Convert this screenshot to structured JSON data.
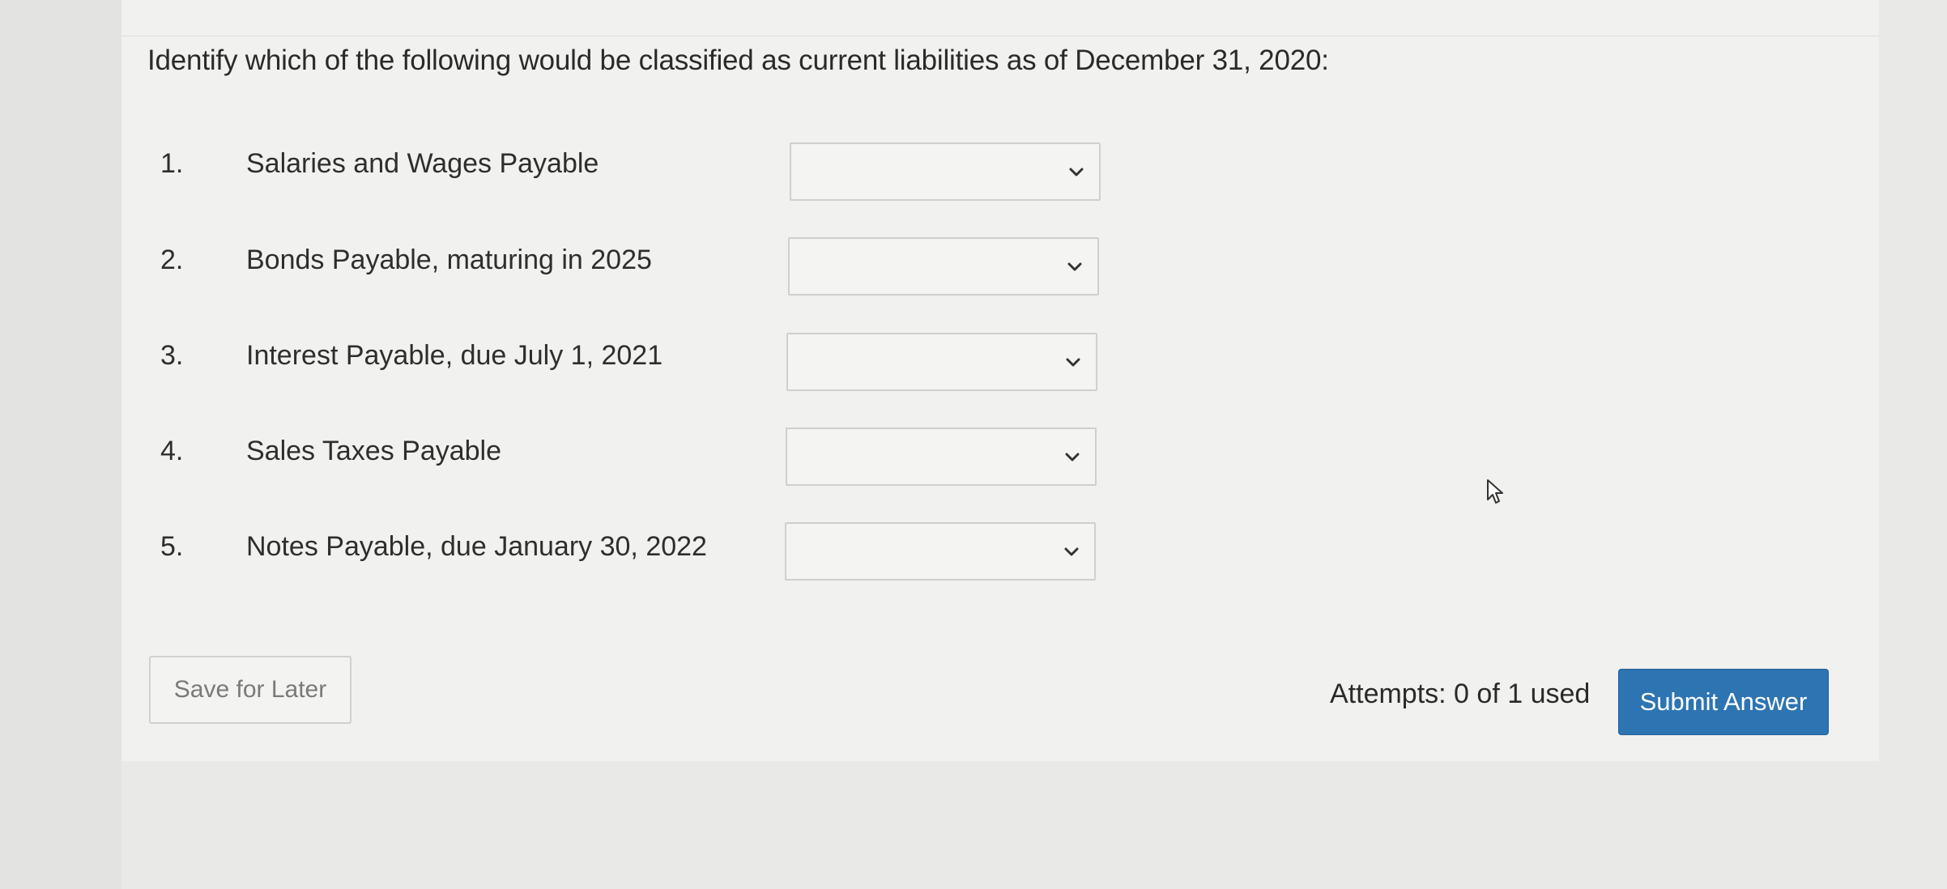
{
  "question": {
    "prompt": "Identify which of the following would be classified as current liabilities as of December 31, 2020:"
  },
  "items": [
    {
      "number": "1.",
      "label": "Salaries and Wages Payable",
      "selected": ""
    },
    {
      "number": "2.",
      "label": "Bonds Payable, maturing in 2025",
      "selected": ""
    },
    {
      "number": "3.",
      "label": "Interest Payable, due July 1, 2021",
      "selected": ""
    },
    {
      "number": "4.",
      "label": "Sales Taxes Payable",
      "selected": ""
    },
    {
      "number": "5.",
      "label": "Notes Payable, due January 30, 2022",
      "selected": ""
    }
  ],
  "footer": {
    "save_label": "Save for Later",
    "attempts_text": "Attempts: 0 of 1 used",
    "submit_label": "Submit Answer"
  },
  "colors": {
    "submit_bg": "#2d74b2",
    "page_bg": "#e9e9e7",
    "card_bg": "#f1f1ef"
  },
  "icons": {
    "dropdown": "chevron-down-icon",
    "cursor": "mouse-pointer-icon"
  }
}
